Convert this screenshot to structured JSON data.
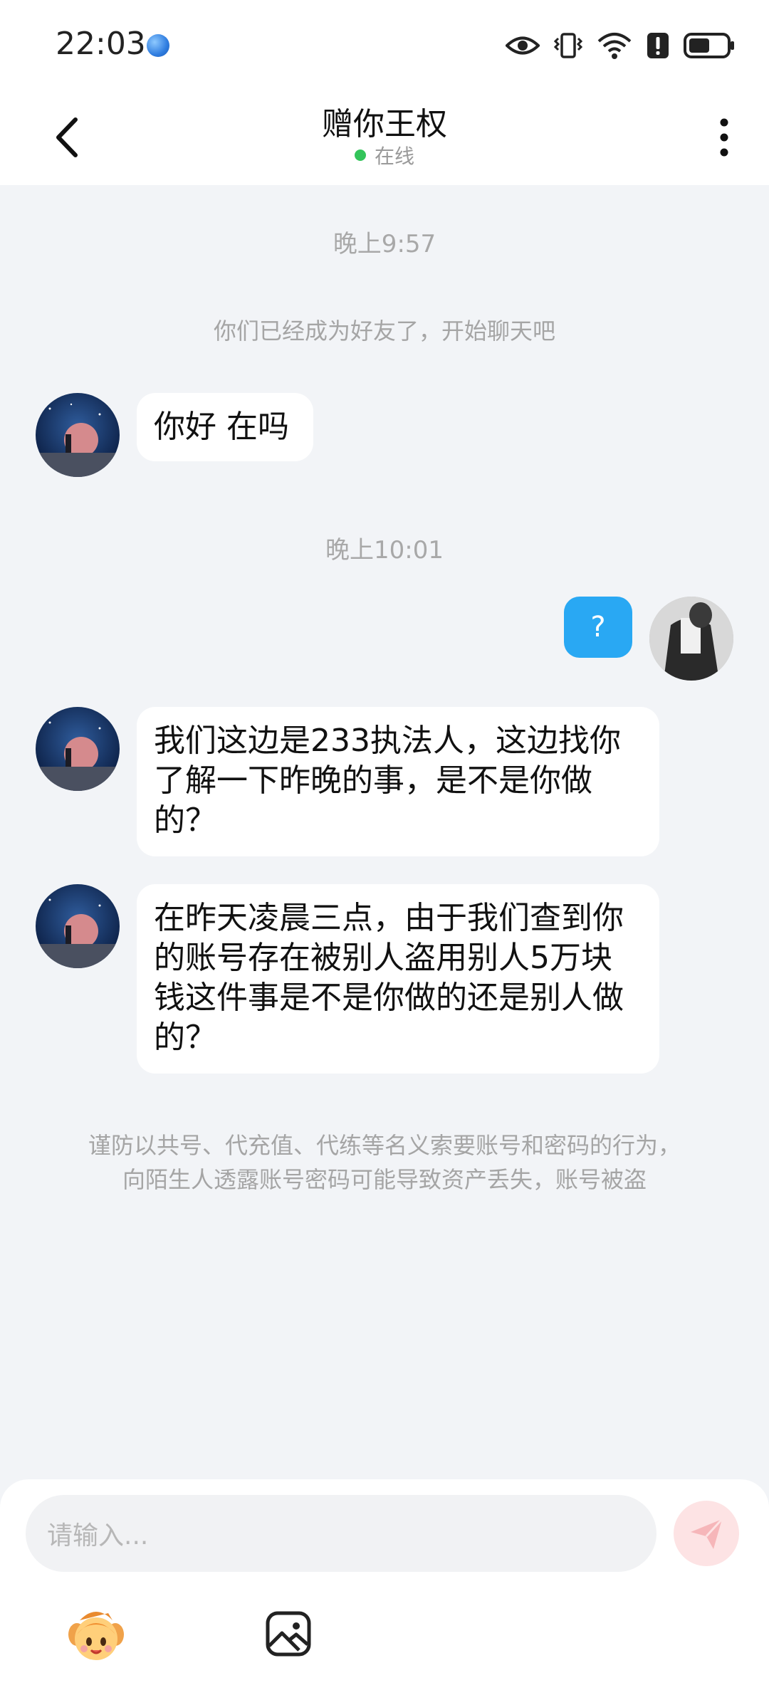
{
  "status_bar": {
    "time": "22:03"
  },
  "header": {
    "title": "赠你王权",
    "status": "在线",
    "status_color": "#33c45a"
  },
  "chat": {
    "timestamp_1": "晚上9:57",
    "system_message": "你们已经成为好友了，开始聊天吧",
    "msg_1": "你好 在吗",
    "timestamp_2": "晚上10:01",
    "msg_sent_1": "?",
    "msg_2": "我们这边是233执法人，这边找你了解一下昨晚的事，是不是你做的？",
    "msg_3": "在昨天凌晨三点，由于我们查到你的账号存在被别人盗用别人5万块钱这件事是不是你做的还是别人做的？",
    "warning_line_1": "谨防以共号、代充值、代练等名义索要账号和密码的行为，",
    "warning_line_2": "向陌生人透露账号密码可能导致资产丢失，账号被盗"
  },
  "input": {
    "placeholder": "请输入..."
  },
  "colors": {
    "sent_bubble": "#29a8f3",
    "background": "#f2f4f7"
  },
  "icons": {
    "back": "back-arrow-icon",
    "more": "more-vertical-icon",
    "send": "send-icon",
    "emoji": "emoji-icon",
    "image": "image-icon"
  }
}
